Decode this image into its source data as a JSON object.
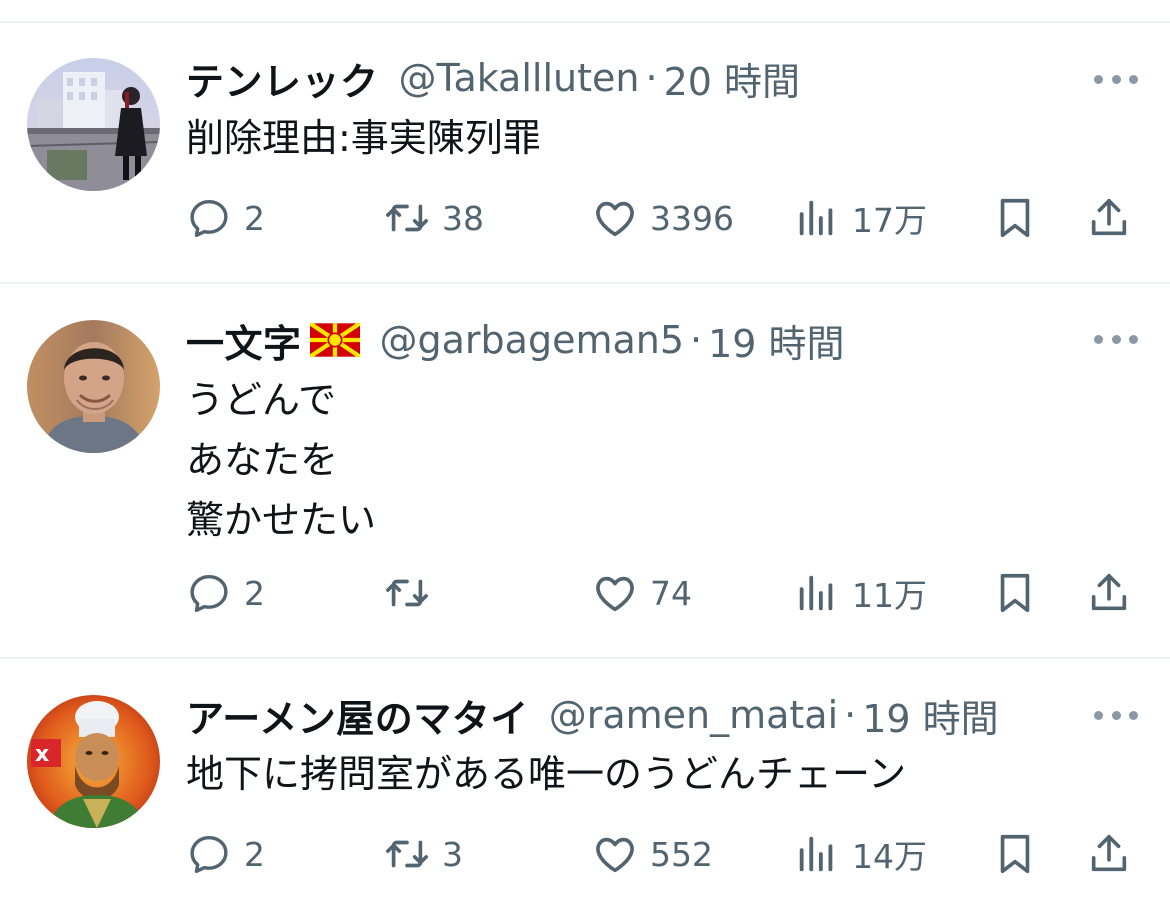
{
  "tweets": [
    {
      "display_name": "テンレック",
      "handle": "@Takallluten",
      "dot": "·",
      "time": "20 時間",
      "body": [
        "削除理由:事実陳列罪"
      ],
      "replies": "2",
      "retweets": "38",
      "likes": "3396",
      "views": "17万"
    },
    {
      "display_name": "一文字",
      "handle": "@garbageman5",
      "dot": "·",
      "time": "19 時間",
      "body": [
        "うどんで",
        "あなたを",
        "驚かせたい"
      ],
      "replies": "2",
      "retweets": "",
      "likes": "74",
      "views": "11万"
    },
    {
      "display_name": "アーメン屋のマタイ",
      "handle": "@ramen_matai",
      "dot": "·",
      "time": "19 時間",
      "body": [
        "地下に拷問室がある唯一のうどんチェーン"
      ],
      "replies": "2",
      "retweets": "3",
      "likes": "552",
      "views": "14万"
    }
  ],
  "icons": {
    "reply": "reply-icon",
    "retweet": "retweet-icon",
    "like": "heart-icon",
    "views": "views-chart-icon",
    "bookmark": "bookmark-icon",
    "share": "share-icon",
    "more": "more-options-icon",
    "flag": "north-macedonia-flag"
  },
  "colors": {
    "text_primary": "#0f1419",
    "text_secondary": "#536471",
    "divider": "#eff3f4"
  }
}
